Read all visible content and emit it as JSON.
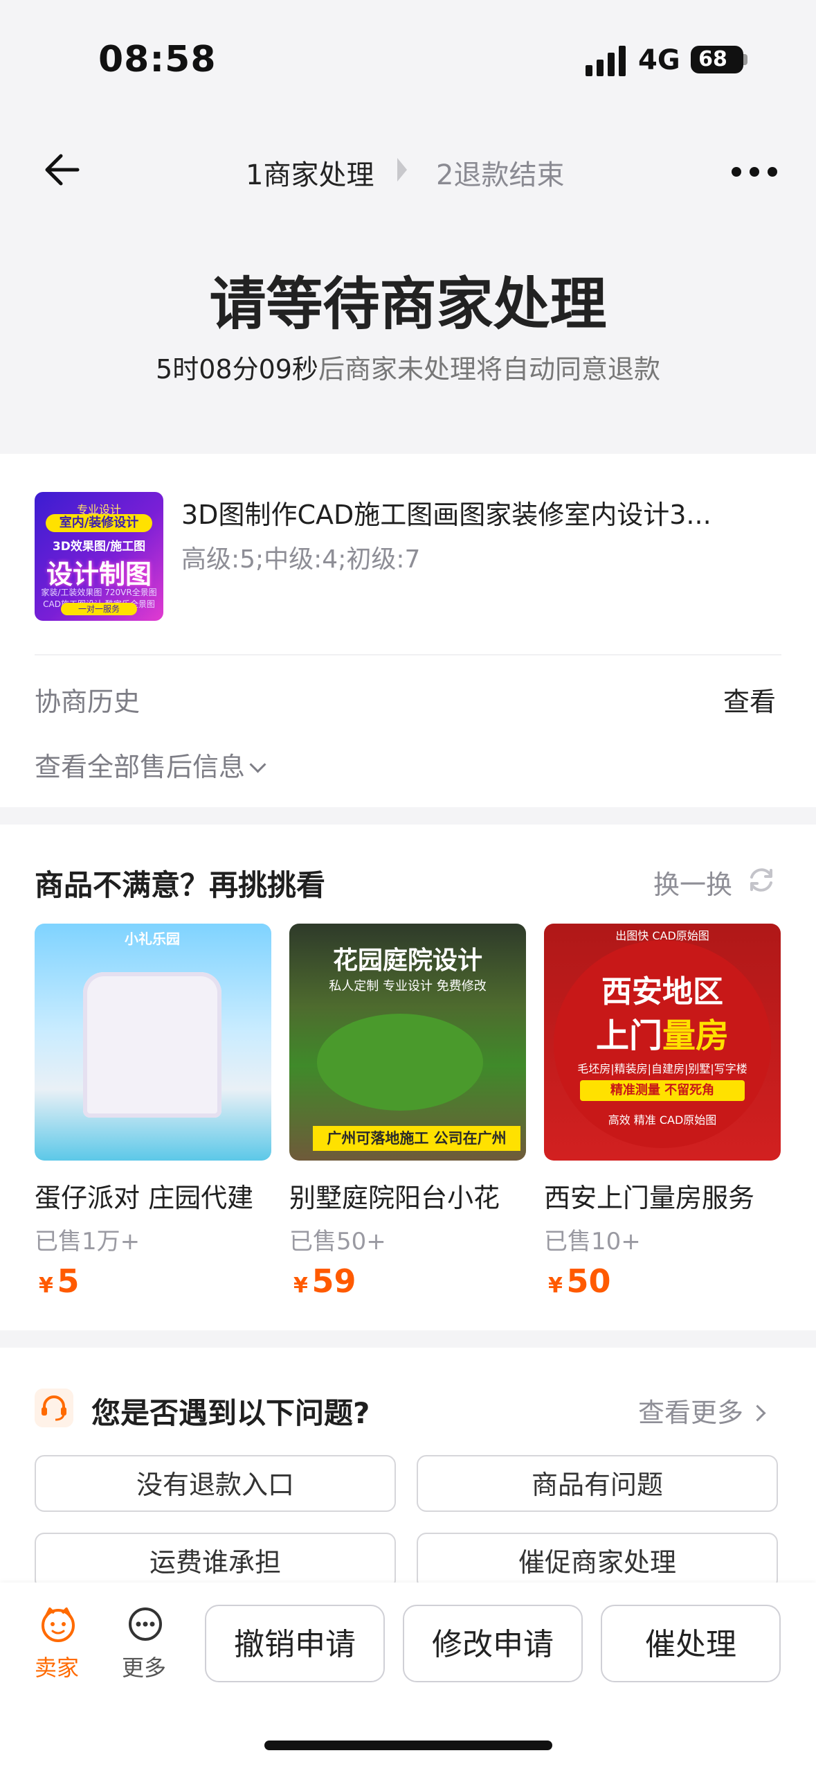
{
  "status_bar": {
    "time": "08:58",
    "network": "4G",
    "battery": "68"
  },
  "nav": {
    "step1": "1商家处理",
    "step2": "2退款结束"
  },
  "header": {
    "title": "请等待商家处理",
    "countdown": "5时08分09秒",
    "countdown_suffix": "后商家未处理将自动同意退款"
  },
  "product": {
    "title": "3D图制作CAD施工图画图家装修室内设计3...",
    "spec": "高级:5;中级:4;初级:7",
    "thumb_text": [
      "专业设计",
      "室内/装修设计",
      "3D效果图/施工图",
      "设计制图",
      "家装/工装效果图 720VR全景图 CAD施工图设计 酷家乐全景图",
      "一对一服务"
    ]
  },
  "history": {
    "label": "协商历史",
    "link": "查看",
    "all_info": "查看全部售后信息"
  },
  "recommend": {
    "title": "商品不满意？再挑挑看",
    "swap": "换一换",
    "items": [
      {
        "name": "蛋仔派对 庄园代建",
        "sold": "已售1万+",
        "currency": "¥",
        "price": "5",
        "img_text": "小礼乐园"
      },
      {
        "name": "别墅庭院阳台小花",
        "sold": "已售50+",
        "currency": "¥",
        "price": "59",
        "img_text": [
          "花园庭院设计",
          "私人定制 专业设计 免费修改",
          "广州可落地施工 公司在广州"
        ]
      },
      {
        "name": "西安上门量房服务",
        "sold": "已售10+",
        "currency": "¥",
        "price": "50",
        "img_text": [
          "出图快 CAD原始图",
          "西安地区",
          "上门",
          "量房",
          "毛坯房|精装房|自建房|别墅|写字楼",
          "精准测量  不留死角",
          "高效 精准 CAD原始图"
        ]
      }
    ]
  },
  "questions": {
    "title": "您是否遇到以下问题?",
    "more": "查看更多",
    "buttons": [
      "没有退款入口",
      "商品有问题",
      "运费谁承担",
      "催促商家处理"
    ]
  },
  "bottom_bar": {
    "seller": "卖家",
    "more": "更多",
    "actions": [
      "撤销申请",
      "修改申请",
      "催处理"
    ]
  },
  "colors": {
    "accent": "#ff6a00",
    "price": "#ff5a00",
    "background": "#f4f4f6"
  }
}
